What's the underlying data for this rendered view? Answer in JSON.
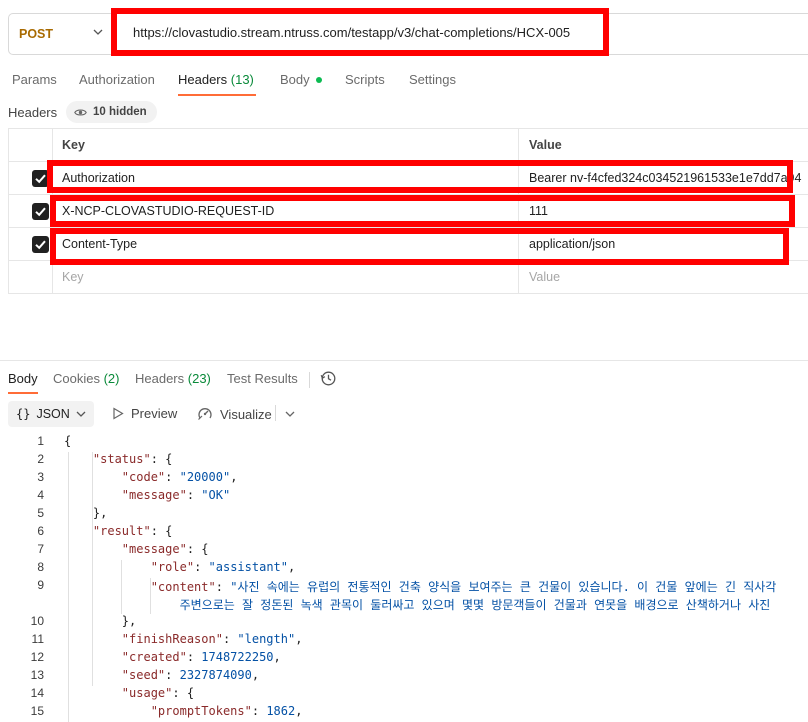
{
  "request": {
    "method": "POST",
    "url": "https://clovastudio.stream.ntruss.com/testapp/v3/chat-completions/HCX-005",
    "tabs": [
      {
        "label": "Params",
        "count": ""
      },
      {
        "label": "Authorization",
        "count": ""
      },
      {
        "label": "Headers",
        "count": "(13)"
      },
      {
        "label": "Body",
        "count": ""
      },
      {
        "label": "Scripts",
        "count": ""
      },
      {
        "label": "Settings",
        "count": ""
      }
    ],
    "active_tab": "Headers",
    "headers_label": "Headers",
    "hidden_count_label": "10 hidden",
    "table": {
      "key_header": "Key",
      "value_header": "Value",
      "rows": [
        {
          "key": "Authorization",
          "value": "Bearer nv-f4cfed324c034521961533e1e7dd7a94",
          "checked": true
        },
        {
          "key": "X-NCP-CLOVASTUDIO-REQUEST-ID",
          "value": "111",
          "checked": true
        },
        {
          "key": "Content-Type",
          "value": "application/json",
          "checked": true
        }
      ],
      "key_placeholder": "Key",
      "value_placeholder": "Value"
    }
  },
  "response": {
    "tabs": [
      {
        "label": "Body",
        "count": ""
      },
      {
        "label": "Cookies",
        "count": "(2)"
      },
      {
        "label": "Headers",
        "count": "(23)"
      },
      {
        "label": "Test Results",
        "count": ""
      }
    ],
    "format": "JSON",
    "preview_label": "Preview",
    "visualize_label": "Visualize",
    "code_lines": [
      {
        "n": "1",
        "text": "{"
      },
      {
        "n": "2",
        "text": "    \"status\": {"
      },
      {
        "n": "3",
        "text": "        \"code\": \"20000\","
      },
      {
        "n": "4",
        "text": "        \"message\": \"OK\""
      },
      {
        "n": "5",
        "text": "    },"
      },
      {
        "n": "6",
        "text": "    \"result\": {"
      },
      {
        "n": "7",
        "text": "        \"message\": {"
      },
      {
        "n": "8",
        "text": "            \"role\": \"assistant\","
      },
      {
        "n": "9",
        "text": "            \"content\": \"사진 속에는 유럽의 전통적인 건축 양식을 보여주는 큰 건물이 있습니다. 이 건물 앞에는 긴 직사각"
      },
      {
        "n": "",
        "text": "                주변으로는 잘 정돈된 녹색 관목이 둘러싸고 있으며 몇몇 방문객들이 건물과 연못을 배경으로 산책하거나 사진"
      },
      {
        "n": "10",
        "text": "        },"
      },
      {
        "n": "11",
        "text": "        \"finishReason\": \"length\","
      },
      {
        "n": "12",
        "text": "        \"created\": 1748722250,"
      },
      {
        "n": "13",
        "text": "        \"seed\": 2327874090,"
      },
      {
        "n": "14",
        "text": "        \"usage\": {"
      },
      {
        "n": "15",
        "text": "            \"promptTokens\": 1862,"
      }
    ]
  },
  "colors": {
    "method": "#a86a00",
    "accent_underline": "#ff6c37",
    "highlight_box": "#ff0000",
    "count_green": "#0a8a3a",
    "json_key": "#8a2a2a",
    "json_value": "#0451a5"
  }
}
